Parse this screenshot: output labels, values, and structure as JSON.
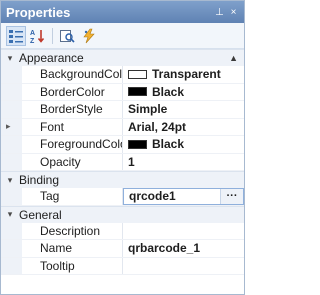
{
  "panel": {
    "title": "Properties",
    "pin_glyph": "⊥",
    "close_glyph": "×"
  },
  "toolbar": {
    "icons": [
      "categorized-icon",
      "alphabetical-icon",
      "property-pages-icon",
      "events-icon"
    ]
  },
  "categories": [
    {
      "name": "Appearance",
      "rows": [
        {
          "name": "BackgroundColor",
          "value": "Transparent",
          "swatch": "#ffffff"
        },
        {
          "name": "BorderColor",
          "value": "Black",
          "swatch": "#000000"
        },
        {
          "name": "BorderStyle",
          "value": "Simple"
        },
        {
          "name": "Font",
          "value": "Arial, 24pt",
          "expandable": true
        },
        {
          "name": "ForegroundColor",
          "value": "Black",
          "swatch": "#000000"
        },
        {
          "name": "Opacity",
          "value": "1"
        }
      ]
    },
    {
      "name": "Binding",
      "rows": [
        {
          "name": "Tag",
          "value": "qrcode1",
          "selected": true,
          "button": "···"
        }
      ]
    },
    {
      "name": "General",
      "rows": [
        {
          "name": "Description",
          "value": ""
        },
        {
          "name": "Name",
          "value": "qrbarcode_1"
        },
        {
          "name": "Tooltip",
          "value": ""
        }
      ]
    }
  ],
  "colors": {
    "titlebar": "#6f91c0",
    "category_bg": "#eef2f8",
    "selected_border": "#8fb0dc"
  }
}
